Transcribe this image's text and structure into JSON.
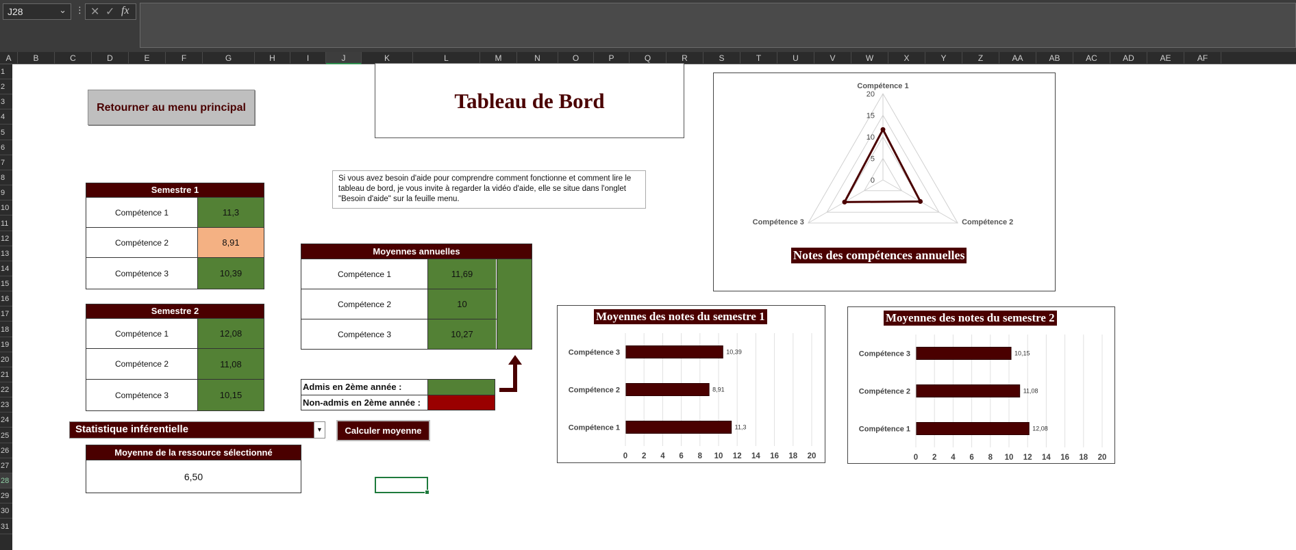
{
  "formula_bar": {
    "name_box": "J28",
    "name_box_chevron": "⌄",
    "cancel_icon": "✕",
    "enter_icon": "✓",
    "fx_label": "fx"
  },
  "columns": [
    "A",
    "B",
    "C",
    "D",
    "E",
    "F",
    "G",
    "H",
    "I",
    "J",
    "K",
    "L",
    "M",
    "N",
    "O",
    "P",
    "Q",
    "R",
    "S",
    "T",
    "U",
    "V",
    "W",
    "X",
    "Y",
    "Z",
    "AA",
    "AB",
    "AC",
    "AD",
    "AE",
    "AF"
  ],
  "rows": [
    "1",
    "2",
    "3",
    "4",
    "5",
    "6",
    "7",
    "8",
    "9",
    "10",
    "11",
    "12",
    "13",
    "14",
    "15",
    "16",
    "17",
    "18",
    "19",
    "20",
    "21",
    "22",
    "23",
    "24",
    "25",
    "26",
    "27",
    "28",
    "29",
    "30",
    "31"
  ],
  "menu_button": "Retourner au menu principal",
  "title": "Tableau de Bord",
  "help_text": "Si vous avez besoin d'aide pour comprendre comment fonctionne et comment lire le tableau de bord, je vous invite à regarder la vidéo d'aide, elle se situe dans l'onglet \"Besoin d'aide\" sur la feuille menu.",
  "semestre1": {
    "title": "Semestre 1",
    "rows": [
      {
        "label": "Compétence 1",
        "value": "11,3"
      },
      {
        "label": "Compétence 2",
        "value": "8,91"
      },
      {
        "label": "Compétence 3",
        "value": "10,39"
      }
    ]
  },
  "semestre2": {
    "title": "Semestre 2",
    "rows": [
      {
        "label": "Compétence 1",
        "value": "12,08"
      },
      {
        "label": "Compétence 2",
        "value": "11,08"
      },
      {
        "label": "Compétence 3",
        "value": "10,15"
      }
    ]
  },
  "annuelles": {
    "title": "Moyennes annuelles",
    "rows": [
      {
        "label": "Compétence 1",
        "value": "11,69"
      },
      {
        "label": "Compétence 2",
        "value": "10"
      },
      {
        "label": "Compétence 3",
        "value": "10,27"
      }
    ]
  },
  "admission": {
    "admis": "Admis en 2ème année :",
    "non_admis": "Non-admis en 2ème année :"
  },
  "dropdown": {
    "value": "Statistique inférentielle",
    "arrow": "▼"
  },
  "calc_button": "Calculer moyenne",
  "ressource": {
    "title": "Moyenne de la ressource sélectionné",
    "value": "6,50"
  },
  "colors": {
    "brand": "#4a0000",
    "good": "#538135",
    "warn": "#f4b183",
    "bad": "#9a0000"
  },
  "chart_data": [
    {
      "type": "radar",
      "title": "Notes des compétences annuelles",
      "axes": [
        "Compétence 1",
        "Compétence 2",
        "Compétence 3"
      ],
      "values": [
        11.69,
        10,
        10.27
      ],
      "rlim": [
        0,
        20
      ],
      "ticks": [
        "0",
        "5",
        "10",
        "15",
        "20"
      ],
      "grid": true,
      "legend": "none"
    },
    {
      "type": "bar",
      "orientation": "horizontal",
      "title": "Moyennes des notes du semestre 1",
      "categories": [
        "Compétence 3",
        "Compétence 2",
        "Compétence 1"
      ],
      "values": [
        10.39,
        8.91,
        11.3
      ],
      "labels": [
        "10,39",
        "8,91",
        "11,3"
      ],
      "xlim": [
        0,
        20
      ],
      "xticks": [
        "0",
        "2",
        "4",
        "6",
        "8",
        "10",
        "12",
        "14",
        "16",
        "18",
        "20"
      ],
      "grid": true,
      "legend": "none"
    },
    {
      "type": "bar",
      "orientation": "horizontal",
      "title": "Moyennes des notes du semestre 2",
      "categories": [
        "Compétence 3",
        "Compétence 2",
        "Compétence 1"
      ],
      "values": [
        10.15,
        11.08,
        12.08
      ],
      "labels": [
        "10,15",
        "11,08",
        "12,08"
      ],
      "xlim": [
        0,
        20
      ],
      "xticks": [
        "0",
        "2",
        "4",
        "6",
        "8",
        "10",
        "12",
        "14",
        "16",
        "18",
        "20"
      ],
      "grid": true,
      "legend": "none"
    }
  ]
}
